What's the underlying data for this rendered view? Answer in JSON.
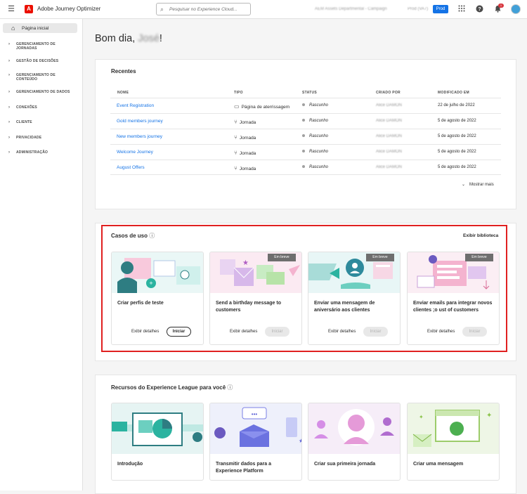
{
  "topbar": {
    "app_name": "Adobe Journey Optimizer",
    "logo_letter": "A",
    "search_placeholder": "Pesquisar no Experience Cloud...",
    "org_name": "AEM Assets Departmental - Campaign",
    "sandbox": "Prod (VA7)",
    "env_badge": "Prod",
    "notification_count": "1"
  },
  "sidebar": {
    "home_label": "Página inicial",
    "items": [
      {
        "label": "GERENCIAMENTO DE JORNADAS"
      },
      {
        "label": "GESTÃO DE DECISÕES"
      },
      {
        "label": "GERENCIAMENTO DE CONTEÚDO"
      },
      {
        "label": "GERENCIAMENTO DE DADOS"
      },
      {
        "label": "CONEXÕES"
      },
      {
        "label": "CLIENTE"
      },
      {
        "label": "PRIVACIDADE"
      },
      {
        "label": "ADMINISTRAÇÃO"
      }
    ]
  },
  "greeting": {
    "prefix": "Bom dia, ",
    "name": "José",
    "suffix": "!"
  },
  "recents": {
    "title": "Recentes",
    "columns": [
      "NOME",
      "TIPO",
      "STATUS",
      "CRIADO POR",
      "MODIFICADO EM"
    ],
    "rows": [
      {
        "name": "Event Registration",
        "type": "Página de aterrissagem",
        "status": "Rascunho",
        "created_by": "Alice DAMON",
        "modified": "22 de julho de 2022"
      },
      {
        "name": "Gold members journey",
        "type": "Jornada",
        "status": "Rascunho",
        "created_by": "Alice DAMON",
        "modified": "5 de agosto de 2022"
      },
      {
        "name": "New members journey",
        "type": "Jornada",
        "status": "Rascunho",
        "created_by": "Alice DAMON",
        "modified": "5 de agosto de 2022"
      },
      {
        "name": "Welcome Journey",
        "type": "Jornada",
        "status": "Rascunho",
        "created_by": "Alice DAMON",
        "modified": "5 de agosto de 2022"
      },
      {
        "name": "August Offers",
        "type": "Jornada",
        "status": "Rascunho",
        "created_by": "Alice DAMON",
        "modified": "5 de agosto de 2022"
      }
    ],
    "show_more": "Mostrar mais"
  },
  "use_cases": {
    "title": "Casos de uso",
    "view_library": "Exibir biblioteca",
    "cards": [
      {
        "title": "Criar perfis de teste",
        "details": "Exibir detalhes",
        "start": "Iniciar",
        "badge": ""
      },
      {
        "title": "Send a birthday message to customers",
        "details": "Exibir detalhes",
        "start": "Iniciar",
        "badge": "Em breve"
      },
      {
        "title": "Enviar uma mensagem de aniversário aos clientes",
        "details": "Exibir detalhes",
        "start": "Iniciar",
        "badge": "Em breve"
      },
      {
        "title": "Enviar emails para integrar novos clientes ;o ust of customers",
        "details": "Exibir detalhes",
        "start": "Iniciar",
        "badge": "Em breve"
      }
    ]
  },
  "resources": {
    "title": "Recursos do Experience League para você",
    "cards": [
      {
        "title": "Introdução"
      },
      {
        "title": "Transmitir dados para a Experience Platform"
      },
      {
        "title": "Criar sua primeira jornada"
      },
      {
        "title": "Criar uma mensagem"
      }
    ]
  },
  "colors": {
    "accent": "#1473e6",
    "highlight_border": "#e02020",
    "logo": "#eb1000"
  }
}
